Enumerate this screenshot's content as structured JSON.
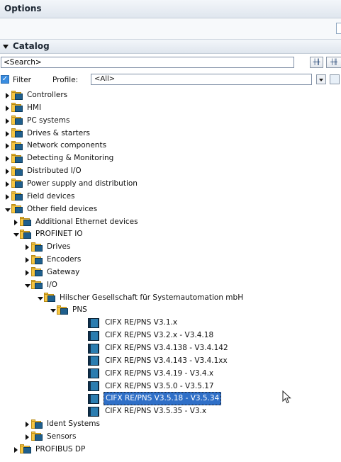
{
  "options_title": "Options",
  "catalog_title": "Catalog",
  "search": {
    "value": "<Search>"
  },
  "filter": {
    "label": "Filter",
    "checked": true
  },
  "profile": {
    "label": "Profile:",
    "value": "<All>"
  },
  "tree": [
    {
      "label": "Controllers",
      "level": 0,
      "type": "folder",
      "expanded": false
    },
    {
      "label": "HMI",
      "level": 0,
      "type": "folder",
      "expanded": false
    },
    {
      "label": "PC systems",
      "level": 0,
      "type": "folder",
      "expanded": false
    },
    {
      "label": "Drives & starters",
      "level": 0,
      "type": "folder",
      "expanded": false
    },
    {
      "label": "Network components",
      "level": 0,
      "type": "folder",
      "expanded": false
    },
    {
      "label": "Detecting & Monitoring",
      "level": 0,
      "type": "folder",
      "expanded": false
    },
    {
      "label": "Distributed I/O",
      "level": 0,
      "type": "folder",
      "expanded": false
    },
    {
      "label": "Power supply and distribution",
      "level": 0,
      "type": "folder",
      "expanded": false
    },
    {
      "label": "Field devices",
      "level": 0,
      "type": "folder",
      "expanded": false
    },
    {
      "label": "Other field devices",
      "level": 0,
      "type": "folder",
      "expanded": true
    },
    {
      "label": "Additional Ethernet devices",
      "level": 1,
      "type": "folder",
      "expanded": false
    },
    {
      "label": "PROFINET IO",
      "level": 1,
      "type": "folder",
      "expanded": true
    },
    {
      "label": "Drives",
      "level": 2,
      "type": "folder",
      "expanded": false
    },
    {
      "label": "Encoders",
      "level": 2,
      "type": "folder",
      "expanded": false
    },
    {
      "label": "Gateway",
      "level": 2,
      "type": "folder",
      "expanded": false
    },
    {
      "label": "I/O",
      "level": 2,
      "type": "folder",
      "expanded": true
    },
    {
      "label": "Hilscher Gesellschaft für Systemautomation mbH",
      "level": 3,
      "type": "folder",
      "expanded": true
    },
    {
      "label": "PNS",
      "level": 4,
      "type": "folder",
      "expanded": true
    },
    {
      "label": "CIFX RE/PNS V3.1.x",
      "level": 5,
      "type": "device"
    },
    {
      "label": "CIFX RE/PNS V3.2.x - V3.4.18",
      "level": 5,
      "type": "device"
    },
    {
      "label": "CIFX RE/PNS V3.4.138 - V3.4.142",
      "level": 5,
      "type": "device"
    },
    {
      "label": "CIFX RE/PNS V3.4.143 - V3.4.1xx",
      "level": 5,
      "type": "device"
    },
    {
      "label": "CIFX RE/PNS V3.4.19 - V3.4.x",
      "level": 5,
      "type": "device"
    },
    {
      "label": "CIFX RE/PNS V3.5.0 - V3.5.17",
      "level": 5,
      "type": "device"
    },
    {
      "label": "CIFX RE/PNS V3.5.18 - V3.5.34",
      "level": 5,
      "type": "device",
      "selected": true
    },
    {
      "label": "CIFX RE/PNS V3.5.35 - V3.x",
      "level": 5,
      "type": "device"
    },
    {
      "label": "Ident Systems",
      "level": 2,
      "type": "folder",
      "expanded": false
    },
    {
      "label": "Sensors",
      "level": 2,
      "type": "folder",
      "expanded": false
    },
    {
      "label": "PROFIBUS DP",
      "level": 1,
      "type": "folder",
      "expanded": false
    }
  ],
  "colors": {
    "selection": "#2f6fc7",
    "header_bg": "#e6ecf2",
    "folder": "#f5c542",
    "module": "#1f5f8d"
  }
}
